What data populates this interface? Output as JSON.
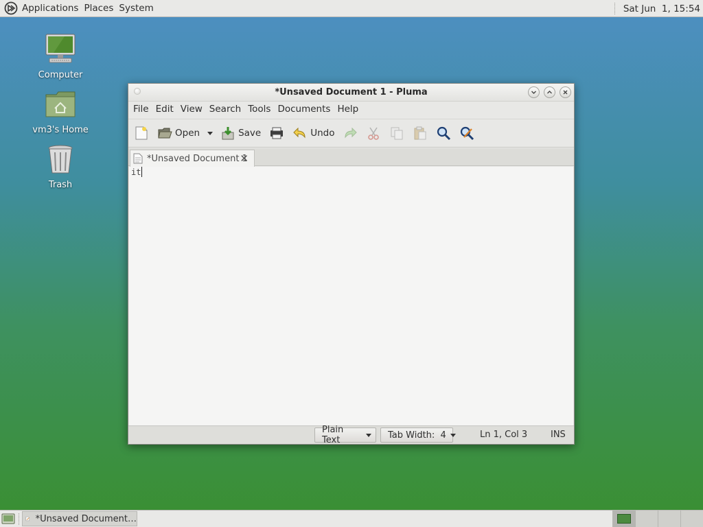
{
  "top_panel": {
    "menus": [
      "Applications",
      "Places",
      "System"
    ],
    "clock": "Sat Jun  1, 15:54"
  },
  "desktop": {
    "icons": [
      {
        "label": "Computer",
        "icon": "computer-icon"
      },
      {
        "label": "vm3's Home",
        "icon": "home-folder-icon"
      },
      {
        "label": "Trash",
        "icon": "trash-icon"
      }
    ]
  },
  "window": {
    "title": "*Unsaved Document 1 - Pluma",
    "menus": [
      "File",
      "Edit",
      "View",
      "Search",
      "Tools",
      "Documents",
      "Help"
    ],
    "toolbar": {
      "open_label": "Open",
      "save_label": "Save",
      "undo_label": "Undo"
    },
    "tab": {
      "label": "*Unsaved Document 1"
    },
    "editor": {
      "content": "it"
    },
    "statusbar": {
      "language": "Plain Text",
      "tab_width": "Tab Width:  4",
      "position": "Ln 1, Col 3",
      "mode": "INS"
    }
  },
  "bottom_panel": {
    "task_label": "*Unsaved Document…"
  },
  "colors": {
    "panel_bg": "#e9e9e7",
    "desktop_top": "#4e8fc3",
    "desktop_bottom": "#3a8f30"
  }
}
